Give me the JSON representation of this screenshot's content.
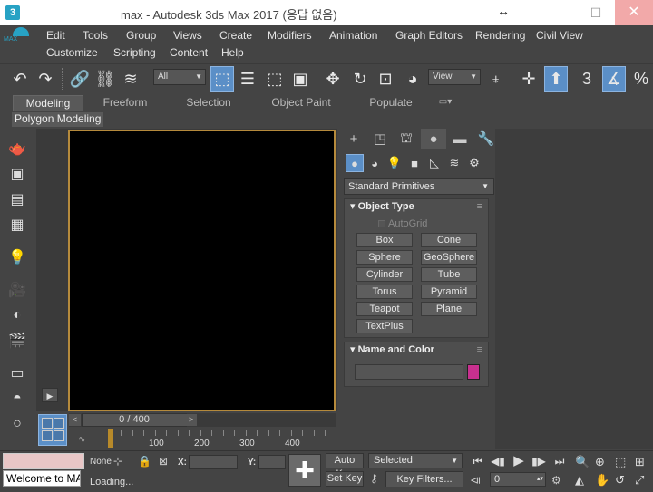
{
  "window": {
    "title": "max - Autodesk 3ds Max 2017  (응답 없음)",
    "app_icon_label": "3",
    "minimize": "—",
    "maximize": "☐",
    "close": "✕"
  },
  "menu": {
    "row1": [
      "Edit",
      "Tools",
      "Group",
      "Views",
      "Create",
      "Modifiers",
      "Animation",
      "Graph Editors",
      "Rendering",
      "Civil View"
    ],
    "row2": [
      "Customize",
      "Scripting",
      "Content",
      "Help"
    ]
  },
  "toolbar": {
    "selection_filter": "All",
    "ref_coord": "View"
  },
  "ribbon": {
    "tabs": [
      "Modeling",
      "Freeform",
      "Selection",
      "Object Paint",
      "Populate"
    ],
    "active_tab": "Modeling",
    "panel_label": "Polygon Modeling"
  },
  "command_panel": {
    "category": "Standard Primitives",
    "object_type": {
      "title": "Object Type",
      "autogrid": "AutoGrid",
      "buttons": [
        "Box",
        "Cone",
        "Sphere",
        "GeoSphere",
        "Cylinder",
        "Tube",
        "Torus",
        "Pyramid",
        "Teapot",
        "Plane",
        "TextPlus"
      ]
    },
    "name_color": {
      "title": "Name and Color",
      "color": "#c8308f"
    }
  },
  "time_slider": {
    "position": "0 / 400",
    "ticks": [
      "100",
      "200",
      "300",
      "400"
    ]
  },
  "status": {
    "maxscript": "Welcome to MA",
    "selection": "None",
    "message": "Loading...",
    "coord_x_label": "X:",
    "coord_y_label": "Y:",
    "auto_key": "Auto Key",
    "set_key": "Set Key",
    "key_mode": "Selected",
    "key_filters": "Key Filters...",
    "frame": "0"
  }
}
